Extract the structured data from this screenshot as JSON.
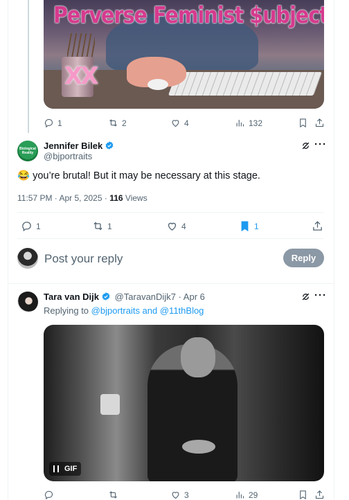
{
  "first_post": {
    "image_title": "Perverse Feminist $ubject",
    "mug_text": "XX",
    "stats": {
      "replies": "1",
      "reposts": "2",
      "likes": "4",
      "views": "132"
    }
  },
  "main_post": {
    "author_name": "Jennifer Bilek",
    "handle": "@bjportraits",
    "avatar_text": "Biological Reality",
    "text": "😂 you’re brutal! But it may be necessary at this stage.",
    "timestamp": "11:57 PM · Apr 5, 2025",
    "views_count": "116",
    "views_label": "Views",
    "stats": {
      "replies": "1",
      "reposts": "1",
      "likes": "4",
      "bookmarks": "1"
    }
  },
  "composer": {
    "placeholder": "Post your reply",
    "reply_button": "Reply"
  },
  "reply_post": {
    "author_name": "Tara van Dijk",
    "handle": "@TaravanDijk7",
    "date": "Apr 6",
    "replying_to_label": "Replying to",
    "replying_to_users": "@bjportraits and @11thBlog",
    "gif_label": "GIF",
    "stats": {
      "likes": "3",
      "views": "29"
    }
  },
  "colors": {
    "accent": "#1d9bf0",
    "muted": "#536471",
    "reply_button_bg": "#8b98a5"
  },
  "icons": [
    "reply-icon",
    "repost-icon",
    "like-icon",
    "views-icon",
    "bookmark-icon",
    "share-icon",
    "verified-icon",
    "grok-icon",
    "more-icon",
    "pause-icon"
  ]
}
